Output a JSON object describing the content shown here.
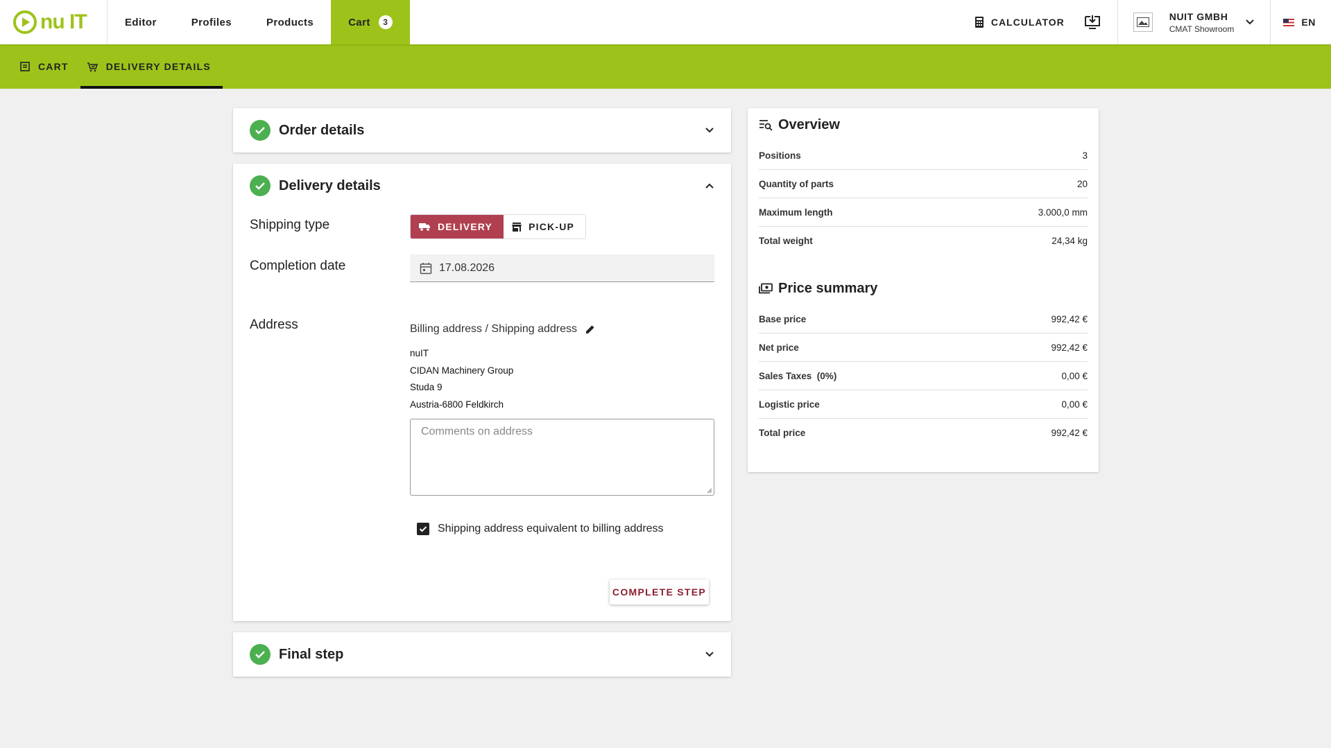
{
  "header": {
    "logo_text": "nu IT",
    "nav": [
      {
        "label": "Editor"
      },
      {
        "label": "Profiles"
      },
      {
        "label": "Products"
      },
      {
        "label": "Cart",
        "badge": "3"
      }
    ],
    "calculator_label": "CALCULATOR",
    "company_name": "NUIT GMBH",
    "company_sub": "CMAT Showroom",
    "language": "EN"
  },
  "subnav": {
    "items": [
      {
        "label": "CART"
      },
      {
        "label": "DELIVERY DETAILS"
      }
    ]
  },
  "steps": {
    "order_details": {
      "title": "Order details"
    },
    "delivery_details": {
      "title": "Delivery details",
      "shipping_type_label": "Shipping type",
      "delivery_label": "DELIVERY",
      "pickup_label": "PICK-UP",
      "completion_label": "Completion date",
      "completion_date": "17.08.2026",
      "address_label": "Address",
      "address_heading": "Billing address / Shipping address",
      "address_lines": [
        "nuIT",
        "CIDAN Machinery Group",
        "Studa 9",
        "Austria-6800 Feldkirch"
      ],
      "comments_placeholder": "Comments on address",
      "same_address_label": "Shipping address equivalent to billing address",
      "complete_label": "COMPLETE STEP"
    },
    "final_step": {
      "title": "Final step"
    }
  },
  "overview": {
    "title": "Overview",
    "rows": [
      {
        "label": "Positions",
        "value": "3"
      },
      {
        "label": "Quantity of parts",
        "value": "20"
      },
      {
        "label": "Maximum length",
        "value": "3.000,0 mm"
      },
      {
        "label": "Total weight",
        "value": "24,34 kg"
      }
    ],
    "price_title": "Price summary",
    "price_rows": [
      {
        "label": "Base price",
        "value": "992,42 €"
      },
      {
        "label": "Net price",
        "value": "992,42 €"
      },
      {
        "label": "Sales Taxes  (0%)",
        "value": "0,00 €"
      },
      {
        "label": "Logistic price",
        "value": "0,00 €"
      },
      {
        "label": "Total price",
        "value": "992,42 €"
      }
    ]
  },
  "colors": {
    "brand_green": "#9dc31a",
    "delivery_active": "#b04050",
    "check_green": "#4caf50"
  }
}
